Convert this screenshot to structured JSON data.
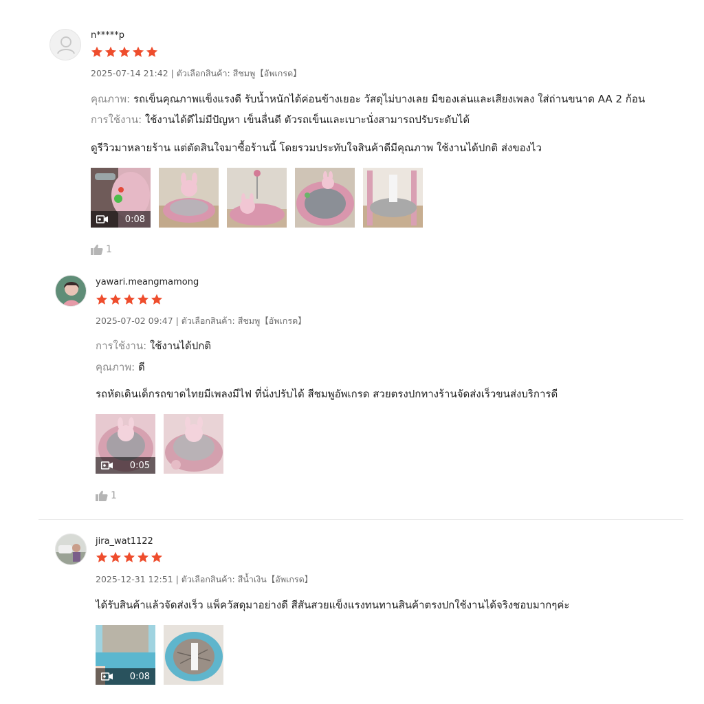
{
  "reviews": [
    {
      "username": "n*****p",
      "rating": 5,
      "date": "2025-07-14 21:42",
      "variant": "| ตัวเลือกสินค้า: สีชมพู【อัพเกรด】",
      "attributes": [
        {
          "key": "คุณภาพ:",
          "value": "รถเข็นคุณภาพแข็งแรงดี รับน้ำหนักได้ค่อนข้างเยอะ วัสดุไม่บางเลย มีของเล่นและเสียงเพลง ใส่ถ่านขนาด AA 2 ก้อน"
        },
        {
          "key": "การใช้งาน:",
          "value": "ใช้งานได้ดีไม่มีปัญหา เข็นลื่นดี ตัวรถเข็นและเบาะนั่งสามารถปรับระดับได้"
        }
      ],
      "comment": "ดูรีวิวมาหลายร้าน แต่ตัดสินใจมาซื้อร้านนี้ โดยรวมประทับใจสินค้าดีมีคุณภาพ ใช้งานได้ปกติ ส่งของไว",
      "video_duration": "0:08",
      "likes": "1"
    },
    {
      "username": "yawari.meangmamong",
      "rating": 5,
      "date": "2025-07-02 09:47",
      "variant": "| ตัวเลือกสินค้า: สีชมพู【อัพเกรด】",
      "attributes": [
        {
          "key": "การใช้งาน:",
          "value": "ใช้งานได้ปกติ"
        },
        {
          "key": "คุณภาพ:",
          "value": "ดี"
        }
      ],
      "comment": "รถหัดเดินเด็กรถขาดไทยมีเพลงมีไฟ ที่นั่งปรับได้ สีชมพูอัพเกรด สวยตรงปกทางร้านจัดส่งเร็วขนส่งบริการดี",
      "video_duration": "0:05",
      "likes": "1"
    },
    {
      "username": "jira_wat1122",
      "rating": 5,
      "date": "2025-12-31 12:51",
      "variant": "| ตัวเลือกสินค้า: สีน้ำเงิน【อัพเกรด】",
      "comment": "ได้รับสินค้าแล้วจัดส่งเร็ว แพ็ควัสดุมาอย่างดี สีสันสวยแข็งแรงทนทานสินค้าตรงปกใช้งานได้จริงชอบมากๆค่ะ",
      "video_duration": "0:08"
    }
  ],
  "colors": {
    "star": "#ee4d2d",
    "muted": "#8a8a8a"
  }
}
